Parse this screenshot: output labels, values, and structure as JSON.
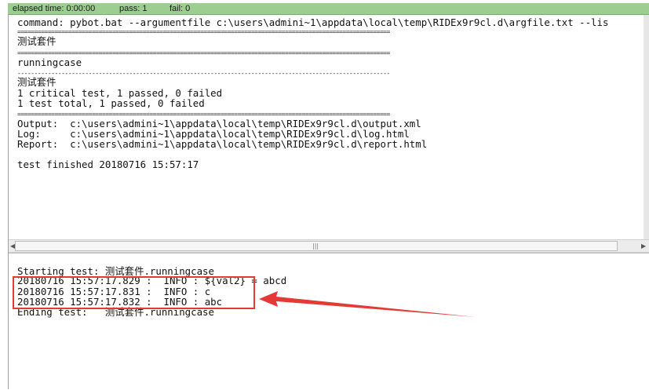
{
  "status": {
    "elapsed": "elapsed time: 0:00:00",
    "pass": "pass: 1",
    "fail": "fail: 0"
  },
  "output_lines": [
    "command: pybot.bat --argumentfile c:\\users\\admini~1\\appdata\\local\\temp\\RIDEx9r9cl.d\\argfile.txt --lis",
    "==============================================================================================================",
    "测试套件",
    "==============================================================================================================",
    "runningcase",
    "--------------------------------------------------------------------------------------------------------------",
    "测试套件",
    "1 critical test, 1 passed, 0 failed",
    "1 test total, 1 passed, 0 failed",
    "==============================================================================================================",
    "Output:  c:\\users\\admini~1\\appdata\\local\\temp\\RIDEx9r9cl.d\\output.xml",
    "Log:     c:\\users\\admini~1\\appdata\\local\\temp\\RIDEx9r9cl.d\\log.html",
    "Report:  c:\\users\\admini~1\\appdata\\local\\temp\\RIDEx9r9cl.d\\report.html",
    "",
    "test finished 20180716 15:57:17"
  ],
  "log_lines": [
    "Starting test: 测试套件.runningcase",
    "20180716 15:57:17.829 :  INFO : ${val2} = abcd",
    "20180716 15:57:17.831 :  INFO : c",
    "20180716 15:57:17.832 :  INFO : abc",
    "Ending test:   测试套件.runningcase"
  ],
  "icons": {
    "scroll_left": "left-arrow-icon",
    "scroll_right": "right-arrow-icon",
    "grip": "grip-icon"
  },
  "colors": {
    "status_bar": "#9ccf8f",
    "annotation": "#e53935"
  }
}
